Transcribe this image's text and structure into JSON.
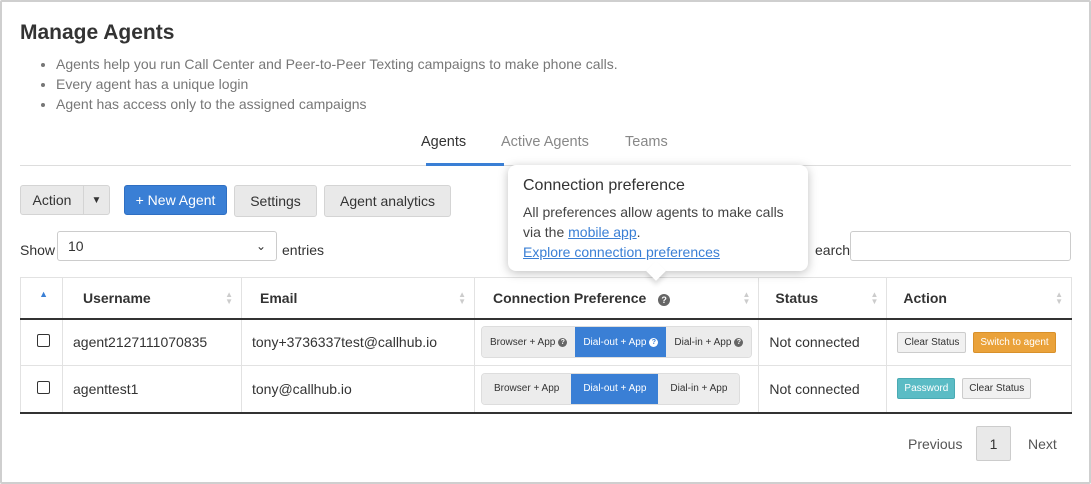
{
  "page": {
    "title": "Manage Agents",
    "bullets": [
      "Agents help you run Call Center and Peer-to-Peer Texting campaigns to make phone calls.",
      "Every agent has a unique login",
      "Agent has access only to the assigned campaigns"
    ]
  },
  "tabs": [
    {
      "label": "Agents",
      "active": true
    },
    {
      "label": "Active Agents",
      "active": false
    },
    {
      "label": "Teams",
      "active": false
    }
  ],
  "toolbar": {
    "action_label": "Action",
    "new_agent_label": "+ New Agent",
    "settings_label": "Settings",
    "analytics_label": "Agent analytics"
  },
  "table_controls": {
    "show_label": "Show",
    "entries_value": "10",
    "entries_label": "entries",
    "search_label": "Search:",
    "search_visible_label": "earch:"
  },
  "table": {
    "headers": [
      "Username",
      "Email",
      "Connection Preference",
      "Status",
      "Action"
    ],
    "rows": [
      {
        "username": "agent2127111070835",
        "email": "tony+3736337test@callhub.io",
        "prefs": [
          "Browser + App",
          "Dial-out + App",
          "Dial-in + App"
        ],
        "selected_pref": "Dial-out + App",
        "status": "Not connected",
        "actions": [
          "Clear Status",
          "Switch to agent"
        ]
      },
      {
        "username": "agenttest1",
        "email": "tony@callhub.io",
        "prefs": [
          "Browser + App",
          "Dial-out + App",
          "Dial-in + App"
        ],
        "selected_pref": "Dial-out + App",
        "status": "Not connected",
        "actions": [
          "Password",
          "Clear Status"
        ]
      }
    ]
  },
  "tooltip": {
    "title": "Connection preference",
    "body_prefix": "All preferences allow agents to make calls via the ",
    "link1": "mobile app",
    "body_suffix": ".",
    "link2": "Explore connection preferences"
  },
  "pagination": {
    "previous": "Previous",
    "current": "1",
    "next": "Next"
  },
  "colors": {
    "primary": "#3a7fd5",
    "orange": "#eaa23a",
    "teal": "#5bbcc5"
  }
}
